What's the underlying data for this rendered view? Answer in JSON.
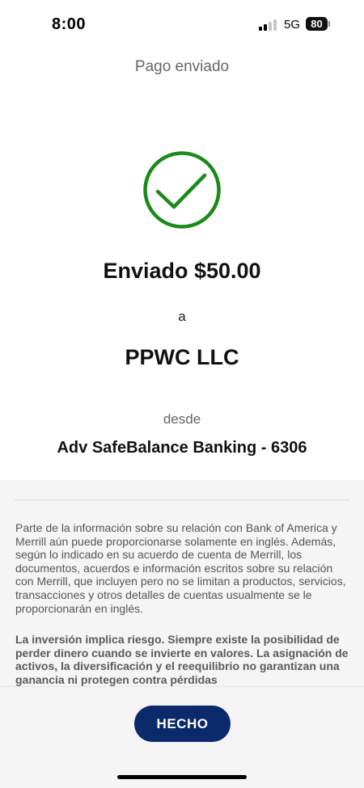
{
  "status_bar": {
    "time": "8:00",
    "network": "5G",
    "battery": "80"
  },
  "header": {
    "title": "Pago enviado"
  },
  "confirmation": {
    "icon": "check-circle-icon",
    "icon_color": "#1a8a1a",
    "amount_line": "Enviado $50.00",
    "to_label": "a",
    "recipient": "PPWC LLC",
    "from_label": "desde",
    "account": "Adv SafeBalance Banking - 6306"
  },
  "disclosure": {
    "paragraph_1": "Parte de la información sobre su relación con Bank of America y Merrill aún puede proporcionarse solamente en inglés. Además, según lo indicado en su acuerdo de cuenta de Merrill, los documentos, acuerdos e información escritos sobre su relación con Merrill, que incluyen pero no se limitan a productos, servicios, transacciones y otros detalles de cuentas usualmente se le proporcionarán en inglés.",
    "paragraph_2": "La inversión implica riesgo. Siempre existe la posibilidad de perder dinero cuando se invierte en valores. La asignación de activos, la diversificación y el reequilibrio no garantizan una ganancia ni protegen contra pérdidas"
  },
  "footer": {
    "done_label": "HECHO",
    "button_color": "#0a2a6b"
  }
}
